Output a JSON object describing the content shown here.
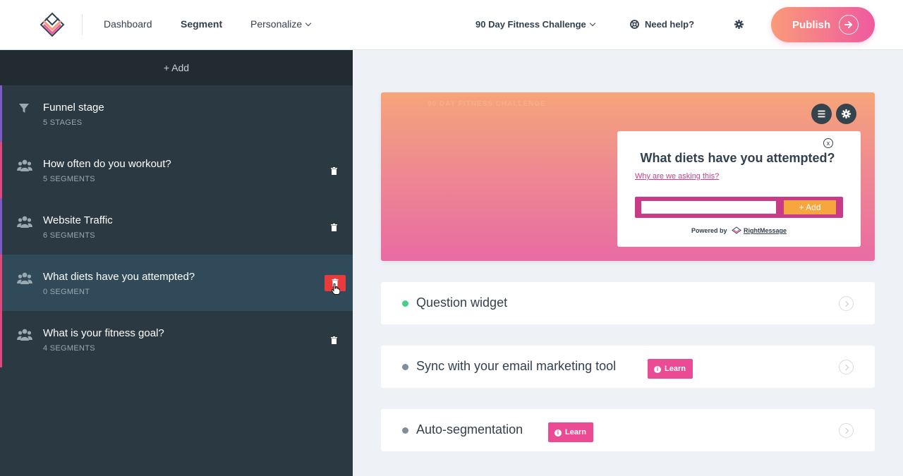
{
  "nav": {
    "dashboard": "Dashboard",
    "segment": "Segment",
    "personalize": "Personalize",
    "campaign": "90 Day Fitness Challenge",
    "help": "Need help?",
    "publish": "Publish"
  },
  "sidebar": {
    "add_label": "+ Add",
    "items": [
      {
        "title": "Funnel stage",
        "subtitle": "5 STAGES",
        "icon": "filter-icon",
        "accent": "#7b5cc4"
      },
      {
        "title": "How often do you workout?",
        "subtitle": "5 SEGMENTS",
        "icon": "users-icon",
        "accent": "#e0457b"
      },
      {
        "title": "Website Traffic",
        "subtitle": "6 SEGMENTS",
        "icon": "users-icon",
        "accent": "#7b5cc4"
      },
      {
        "title": "What diets have you attempted?",
        "subtitle": "0 SEGMENT",
        "icon": "users-icon",
        "accent": "#e0457b",
        "selected": true
      },
      {
        "title": "What is your fitness goal?",
        "subtitle": "4 SEGMENTS",
        "icon": "users-icon",
        "accent": "#e0457b"
      }
    ]
  },
  "preview": {
    "ghost_title": "90 DAY FITNESS CHALLENGE",
    "question": "What diets have you attempted?",
    "why_link": "Why are we asking this?",
    "add_button": "+ Add",
    "powered_by": "Powered by",
    "brand": "RightMessage",
    "close": "x"
  },
  "cards": [
    {
      "title": "Question widget",
      "dot_color": "#45d08a",
      "learn": ""
    },
    {
      "title": "Sync with your email marketing tool",
      "dot_color": "#7f8e99",
      "learn": "Learn"
    },
    {
      "title": "Auto-segmentation",
      "dot_color": "#7f8e99",
      "learn": "Learn"
    }
  ],
  "colors": {
    "accent_pink": "#ea4b94",
    "delete_red": "#e83b3b",
    "sidebar_bg": "#2b3a42"
  }
}
